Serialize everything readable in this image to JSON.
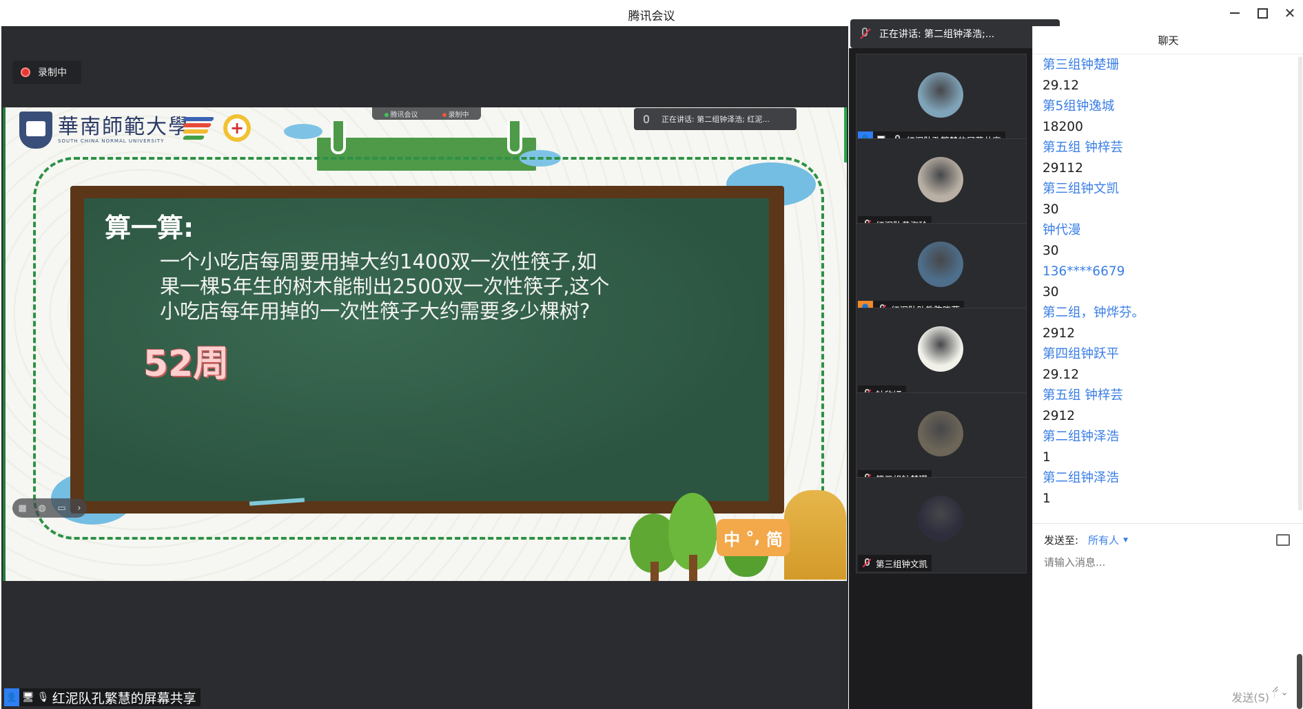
{
  "window": {
    "title": "腾讯会议"
  },
  "recording": {
    "label": "录制中"
  },
  "speaker": {
    "text": "正在讲话: 第二组钟泽浩;..."
  },
  "slide": {
    "school_cn": "華南師範大學",
    "school_en": "SOUTH CHINA NORMAL UNIVERSITY",
    "inner_bar": {
      "app": "腾讯会议",
      "rec": "录制中"
    },
    "inner_speaker": "正在讲话: 第二组钟泽浩; 红泥...",
    "title": "算一算:",
    "question": "一个小吃店每周要用掉大约1400双一次性筷子,如果一棵5年生的树木能制出2500双一次性筷子,这个小吃店每年用掉的一次性筷子大约需要多少棵树?",
    "answer": "52周",
    "ime": {
      "a": "中",
      "b": "°,",
      "c": "简"
    }
  },
  "share_label": "红泥队孔繁慧的屏幕共享",
  "participants": [
    {
      "name": "红泥队孔繁慧的屏幕共享",
      "muted": false,
      "host": true,
      "sharing": true,
      "avatar_color": "#7fa3b8"
    },
    {
      "name": "红泥队黄海玲",
      "muted": true,
      "host": false,
      "sharing": false,
      "avatar_color": "#b9b0a4"
    },
    {
      "name": "红泥队助教陈晓燕",
      "muted": true,
      "host": true,
      "sharing": false,
      "avatar_color": "#4e6f8c"
    },
    {
      "name": "钟欣妍",
      "muted": true,
      "host": false,
      "sharing": false,
      "avatar_color": "#f1f1ea"
    },
    {
      "name": "第三组钟楚珊",
      "muted": true,
      "host": false,
      "sharing": false,
      "avatar_color": "#6d6658"
    },
    {
      "name": "第三组钟文凯",
      "muted": true,
      "host": false,
      "sharing": false,
      "avatar_color": "#2d2d3c"
    }
  ],
  "chat": {
    "title": "聊天",
    "messages": [
      {
        "sender": "第三组钟楚珊",
        "text": "29.12"
      },
      {
        "sender": "第5组钟逸城",
        "text": "18200"
      },
      {
        "sender": "第五组 钟梓芸",
        "text": "29112"
      },
      {
        "sender": "第三组钟文凯",
        "text": "30"
      },
      {
        "sender": "钟代漫",
        "text": "30"
      },
      {
        "sender": "136****6679",
        "text": "30"
      },
      {
        "sender": "第二组，钟烨芬。",
        "text": "2912"
      },
      {
        "sender": "第四组钟跃平",
        "text": "29.12"
      },
      {
        "sender": "第五组 钟梓芸",
        "text": "2912"
      },
      {
        "sender": "第二组钟泽浩",
        "text": "1"
      },
      {
        "sender": "第二组钟泽浩",
        "text": "1"
      }
    ],
    "send_to_label": "发送至:",
    "send_to_value": "所有人",
    "input_placeholder": "请输入消息...",
    "send_label": "发送(S)"
  }
}
